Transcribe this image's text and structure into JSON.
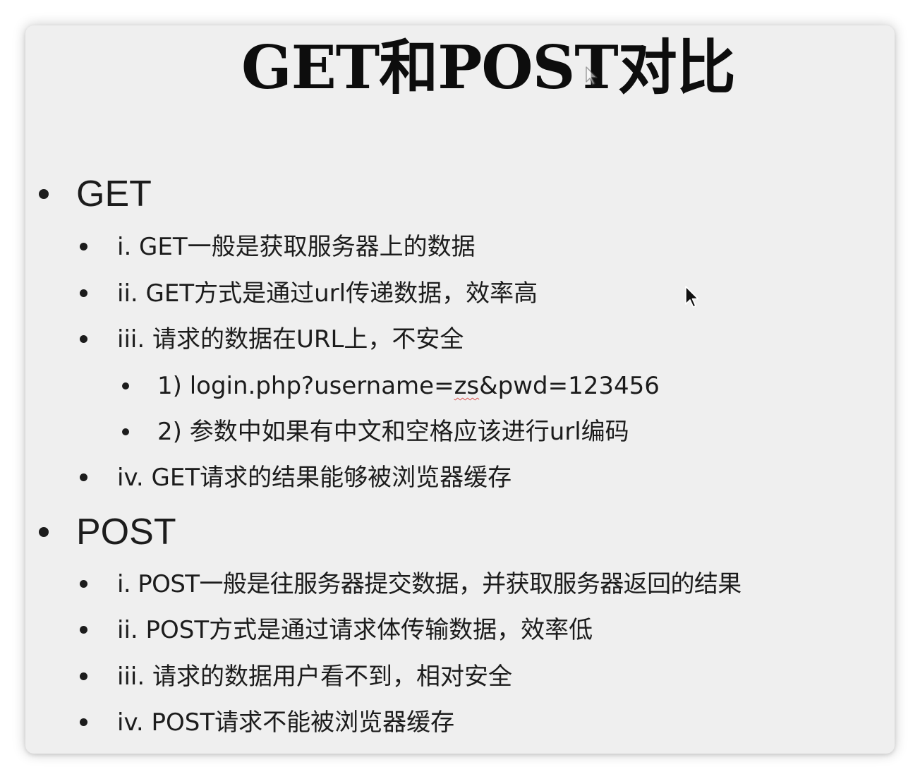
{
  "title": "GET和POST对比",
  "get_section": {
    "heading": "GET",
    "items": [
      "i. GET一般是获取服务器上的数据",
      "ii. GET方式是通过url传递数据，效率高",
      "iii. 请求的数据在URL上，不安全",
      "iv. GET请求的结果能够被浏览器缓存"
    ],
    "sub_items": {
      "s1_prefix": "1) login.php?username=",
      "s1_flagged": "zs",
      "s1_suffix": "&pwd=123456",
      "s2": "2) 参数中如果有中文和空格应该进行url编码"
    }
  },
  "post_section": {
    "heading": "POST",
    "items": [
      "i. POST一般是往服务器提交数据，并获取服务器返回的结果",
      "ii. POST方式是通过请求体传输数据，效率低",
      "iii. 请求的数据用户看不到，相对安全",
      "iv. POST请求不能被浏览器缓存"
    ]
  },
  "colors": {
    "slide_background": "#efefef",
    "text": "#1c1c1c",
    "spellcheck_underline": "#d9534f"
  },
  "icons": [
    "cursor-arrow-icon",
    "bullet-dot-icon"
  ]
}
